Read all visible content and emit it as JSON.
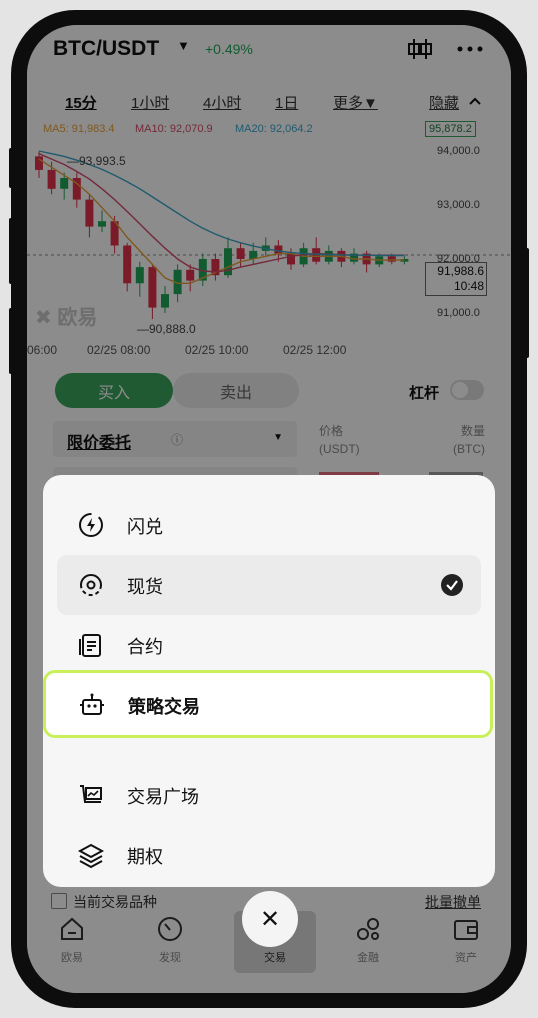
{
  "header": {
    "pair": "BTC/USDT",
    "change": "+0.49%"
  },
  "timeframes": [
    {
      "label": "15分",
      "active": true
    },
    {
      "label": "1小时",
      "active": false
    },
    {
      "label": "4小时",
      "active": false
    },
    {
      "label": "1日",
      "active": false
    },
    {
      "label": "更多▼",
      "active": false
    },
    {
      "label": "隐藏",
      "active": false
    }
  ],
  "indicators": {
    "ma5": "MA5: 91,983.4",
    "ma10": "MA10: 92,070.9",
    "ma20": "MA20: 92,064.2",
    "last_high": "95,878.2"
  },
  "chart_data": {
    "type": "candlestick",
    "y_ticks": [
      "94,000.0",
      "93,000.0",
      "92,000.0",
      "91,000.0"
    ],
    "x_ticks": [
      "06:00",
      "02/25 08:00",
      "02/25 10:00",
      "02/25 12:00"
    ],
    "annotations": {
      "high": "93,993.5",
      "low": "90,888.0",
      "current": "91,988.6",
      "countdown": "10:48"
    },
    "watermark": "欧易"
  },
  "trade": {
    "buy_label": "买入",
    "sell_label": "卖出",
    "leverage_label": "杠杆",
    "order_type": "限价委托",
    "price_col": "价格",
    "price_unit": "(USDT)",
    "qty_col": "数量",
    "qty_unit": "(BTC)",
    "current_symbol_label": "当前交易品种",
    "batch_cancel": "批量撤单"
  },
  "menu": {
    "items": [
      {
        "label": "闪兑",
        "icon": "flash-swap-icon"
      },
      {
        "label": "现货",
        "icon": "spot-icon",
        "selected": true
      },
      {
        "label": "合约",
        "icon": "contract-icon"
      },
      {
        "label": "策略交易",
        "icon": "bot-icon",
        "highlighted": true
      },
      {
        "label": "交易广场",
        "icon": "trade-square-icon"
      },
      {
        "label": "期权",
        "icon": "options-icon"
      }
    ]
  },
  "nav": [
    {
      "label": "欧易",
      "icon": "home-icon"
    },
    {
      "label": "发现",
      "icon": "discover-icon"
    },
    {
      "label": "交易",
      "icon": "close-icon"
    },
    {
      "label": "金融",
      "icon": "finance-icon"
    },
    {
      "label": "资产",
      "icon": "wallet-icon"
    }
  ],
  "colors": {
    "accent_green": "#3aa55d",
    "highlight_border": "#c9f05a",
    "up": "#22a75a",
    "down": "#e0304a"
  }
}
